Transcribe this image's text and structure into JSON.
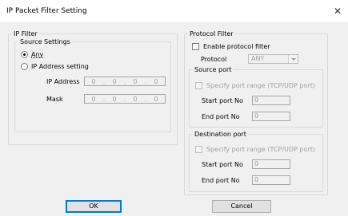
{
  "window": {
    "title": "IP Packet Filter Setting",
    "close_glyph": "✕"
  },
  "ip_filter": {
    "legend": "IP Filter",
    "source_settings": {
      "legend": "Source Settings",
      "any_label": "Any",
      "ip_setting_label": "IP Address setting",
      "selected": "any"
    },
    "ip_address_label": "IP Address",
    "ip_address": [
      "0",
      "0",
      "0",
      "0"
    ],
    "mask_label": "Mask",
    "mask": [
      "0",
      "0",
      "0",
      "0"
    ]
  },
  "protocol_filter": {
    "legend": "Protocol Filter",
    "enable_label": "Enable protocol filter",
    "enabled": false,
    "protocol_label": "Protocol",
    "protocol_value": "ANY"
  },
  "source_port": {
    "legend": "Source port",
    "specify_label": "Specify port range (TCP/UDP port)",
    "start_label": "Start port No",
    "start_value": "0",
    "end_label": "End port No",
    "end_value": "0"
  },
  "destination_port": {
    "legend": "Destination port",
    "specify_label": "Specify port range (TCP/UDP port)",
    "start_label": "Start port No",
    "start_value": "0",
    "end_label": "End port No",
    "end_value": "0"
  },
  "buttons": {
    "ok": "OK",
    "cancel": "Cancel"
  }
}
